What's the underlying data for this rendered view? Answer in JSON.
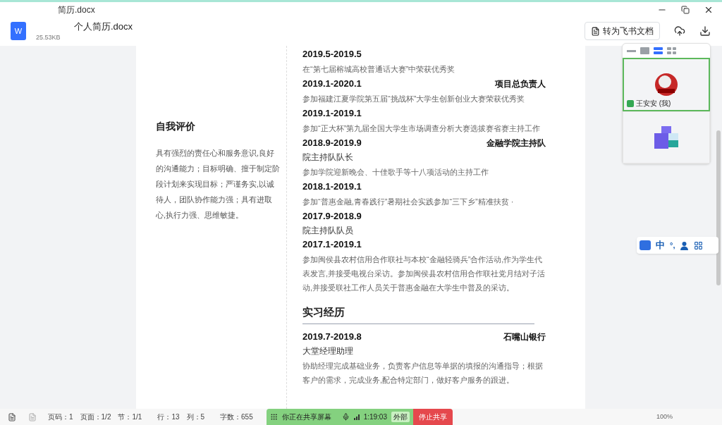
{
  "window": {
    "title": "简历.docx"
  },
  "file": {
    "name": "个人简历.docx",
    "size": "25.53KB",
    "icon_letter": "W"
  },
  "toolbar": {
    "convert_button": "转为飞书文档"
  },
  "video_panel": {
    "layouts": [
      {
        "selected": false
      },
      {
        "selected": false
      },
      {
        "selected": true
      },
      {
        "selected": false
      }
    ],
    "participants": [
      {
        "name": "王安安 (我)",
        "sharing": true,
        "active": true
      },
      {
        "active": false
      }
    ]
  },
  "ime_toolbar": {
    "items": [
      "中",
      "°,"
    ]
  },
  "document": {
    "self_eval": {
      "heading": "自我评价",
      "text": "具有强烈的责任心和服务意识,良好的沟通能力；目标明确、擅于制定阶段计划来实现目标；严谨务实,以诚待人，团队协作能力强；具有进取心,执行力强、思维敏捷。"
    },
    "entries": [
      {
        "kind": "entry",
        "date": "2019.5-2019.5",
        "lines": [
          {
            "kind": "desc",
            "text": "在“第七届榕城高校普通话大赛”中荣获优秀奖"
          }
        ]
      },
      {
        "kind": "entry",
        "date": "2019.1-2020.1",
        "role": "项目总负责人",
        "lines": [
          {
            "kind": "desc",
            "text": "参加福建江夏学院第五届“挑战杯”大学生创新创业大赛荣获优秀奖"
          }
        ]
      },
      {
        "kind": "entry",
        "date": "2019.1-2019.1",
        "lines": [
          {
            "kind": "desc",
            "text": "参加“正大杯”第九届全国大学生市场调查分析大赛选拔赛省赛主持工作"
          }
        ]
      },
      {
        "kind": "entry",
        "date": "2018.9-2019.9",
        "role": "金融学院主持队",
        "lines": [
          {
            "kind": "title",
            "text": "院主持队队长"
          },
          {
            "kind": "desc",
            "text": "参加学院迎新晚会、十佳歌手等十八项活动的主持工作"
          }
        ]
      },
      {
        "kind": "entry",
        "date": "2018.1-2019.1",
        "lines": [
          {
            "kind": "desc",
            "text": "参加“普惠金融,青春践行”暑期社会实践参加“三下乡”精准扶贫 ·"
          }
        ]
      },
      {
        "kind": "entry",
        "date": "2017.9-2018.9",
        "lines": [
          {
            "kind": "title",
            "text": "院主持队队员"
          }
        ]
      },
      {
        "kind": "entry",
        "date": "2017.1-2019.1",
        "lines": [
          {
            "kind": "desc",
            "text": "参加闽侯县农村信用合作联社与本校“金融轻骑兵”合作活动,作为学生代表发言,并接受电视台采访。参加闽侯县农村信用合作联社党月结对子活动,并接受联社工作人员关于普惠金融在大学生中普及的采访。"
          }
        ]
      },
      {
        "kind": "section",
        "heading": "实习经历"
      },
      {
        "kind": "entry",
        "date": "2019.7-2019.8",
        "role": "石嘴山银行",
        "lines": [
          {
            "kind": "title",
            "text": "大堂经理助理"
          },
          {
            "kind": "desc",
            "text": "协助经理完成基础业务，负责客户信息等单据的填报的沟通指导；根据客户的需求，完成业务,配合特定部门，做好客户服务的跟进。"
          }
        ]
      }
    ]
  },
  "status_bar": {
    "items": [
      "页码：1",
      "页面：1/2",
      "节：1/1",
      "行：13",
      "列：5",
      "字数：655"
    ],
    "zoom": "100%"
  },
  "share_bar": {
    "label": "你正在共享屏幕",
    "time": "1:19:03",
    "tag": "外部",
    "stop_button": "停止共享"
  }
}
